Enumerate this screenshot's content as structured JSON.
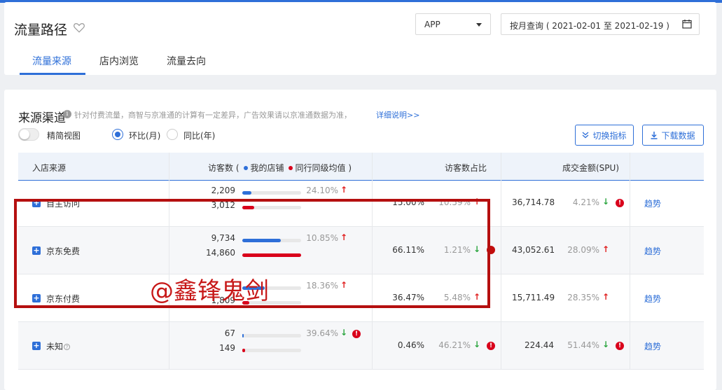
{
  "header": {
    "title": "流量路径",
    "platform_select": "APP",
    "date_range": "按月查询 ( 2021-02-01 至 2021-02-19 )",
    "tabs": [
      {
        "label": "流量来源",
        "active": true
      },
      {
        "label": "店内浏览",
        "active": false
      },
      {
        "label": "流量去向",
        "active": false
      }
    ]
  },
  "section": {
    "title": "来源渠道",
    "description": "针对付费流量，商智与京准通的计算有一定差异，广告效果请以京准通数据为准，",
    "detail_link": "详细说明>>",
    "toggle_label": "精简视图",
    "radio_mom": "环比(月)",
    "radio_yoy": "同比(年)",
    "switch_metric_btn": "切换指标",
    "download_btn": "下载数据"
  },
  "table": {
    "headers": {
      "source": "入店来源",
      "visitors": "访客数 (",
      "my_store": "我的店铺",
      "peer_avg": "同行同级均值 )",
      "share": "访客数占比",
      "amount": "成交金额(SPU)"
    },
    "rows": [
      {
        "name": "自主访问",
        "my_visitors": "2,209",
        "peer_visitors": "3,012",
        "my_bar": 0.15,
        "peer_bar": 0.2,
        "visitor_change": "24.10%",
        "visitor_dir": "up",
        "visitor_warn": false,
        "share": "15.00%",
        "share_change": "10.59%",
        "share_dir": "up",
        "share_warn": false,
        "amount": "36,714.78",
        "amount_change": "4.21%",
        "amount_dir": "down",
        "amount_warn": true,
        "trend": "趋势"
      },
      {
        "name": "京东免费",
        "my_visitors": "9,734",
        "peer_visitors": "14,860",
        "my_bar": 0.66,
        "peer_bar": 1.0,
        "visitor_change": "10.85%",
        "visitor_dir": "up",
        "visitor_warn": false,
        "share": "66.11%",
        "share_change": "1.21%",
        "share_dir": "down",
        "share_warn": false,
        "amount": "43,052.61",
        "amount_change": "28.09%",
        "amount_dir": "up",
        "amount_warn": false,
        "trend": "趋势"
      },
      {
        "name": "京东付费",
        "my_visitors": "",
        "peer_visitors": "1,809",
        "my_bar": 0.38,
        "peer_bar": 0.12,
        "visitor_change": "18.36%",
        "visitor_dir": "up",
        "visitor_warn": false,
        "share": "36.47%",
        "share_change": "5.48%",
        "share_dir": "up",
        "share_warn": false,
        "amount": "15,711.49",
        "amount_change": "28.35%",
        "amount_dir": "up",
        "amount_warn": false,
        "trend": "趋势"
      },
      {
        "name": "未知",
        "my_visitors": "67",
        "peer_visitors": "149",
        "my_bar": 0.02,
        "peer_bar": 0.05,
        "visitor_change": "39.64%",
        "visitor_dir": "down",
        "visitor_warn": true,
        "share": "0.46%",
        "share_change": "46.21%",
        "share_dir": "down",
        "share_warn": true,
        "amount": "224.44",
        "amount_change": "51.44%",
        "amount_dir": "down",
        "amount_warn": true,
        "trend": "趋势"
      }
    ]
  },
  "watermark": "@鑫锋鬼剑",
  "colors": {
    "accent": "#2e6fd8",
    "my_store": "#2e6fd8",
    "peer": "#d9001b",
    "up": "#e02020",
    "down": "#2da641"
  }
}
